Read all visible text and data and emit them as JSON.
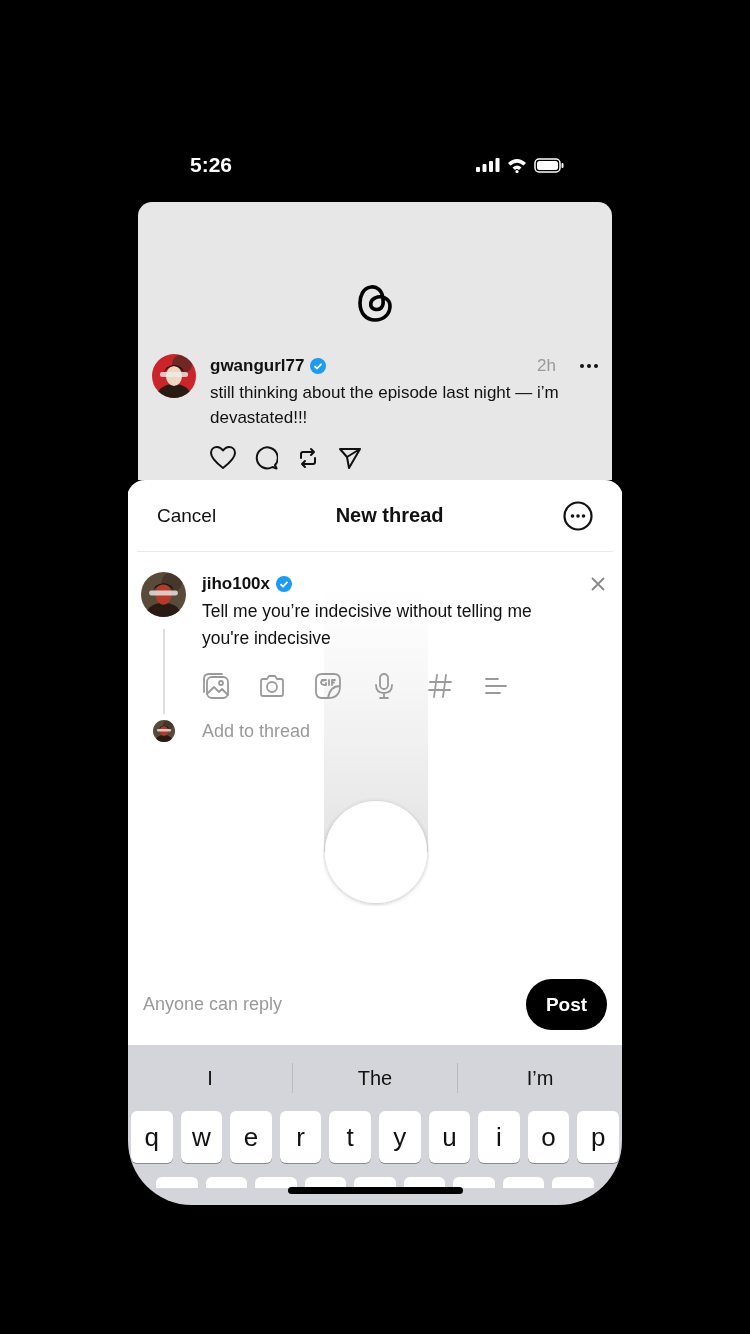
{
  "status_bar": {
    "time": "5:26"
  },
  "background_post": {
    "username": "gwangurl77",
    "verified": true,
    "time": "2h",
    "text": "still thinking about the episode last night — i’m devastated!!!"
  },
  "composer": {
    "cancel": "Cancel",
    "title": "New thread",
    "username": "jiho100x",
    "verified": true,
    "text": "Tell me you’re indecisive without telling me you're indecisive",
    "add_placeholder": "Add to thread",
    "reply_setting": "Anyone can reply",
    "post_button": "Post"
  },
  "keyboard": {
    "suggestions": [
      "I",
      "The",
      "I’m"
    ],
    "rows": [
      [
        "q",
        "w",
        "e",
        "r",
        "t",
        "y",
        "u",
        "i",
        "o",
        "p"
      ]
    ]
  }
}
